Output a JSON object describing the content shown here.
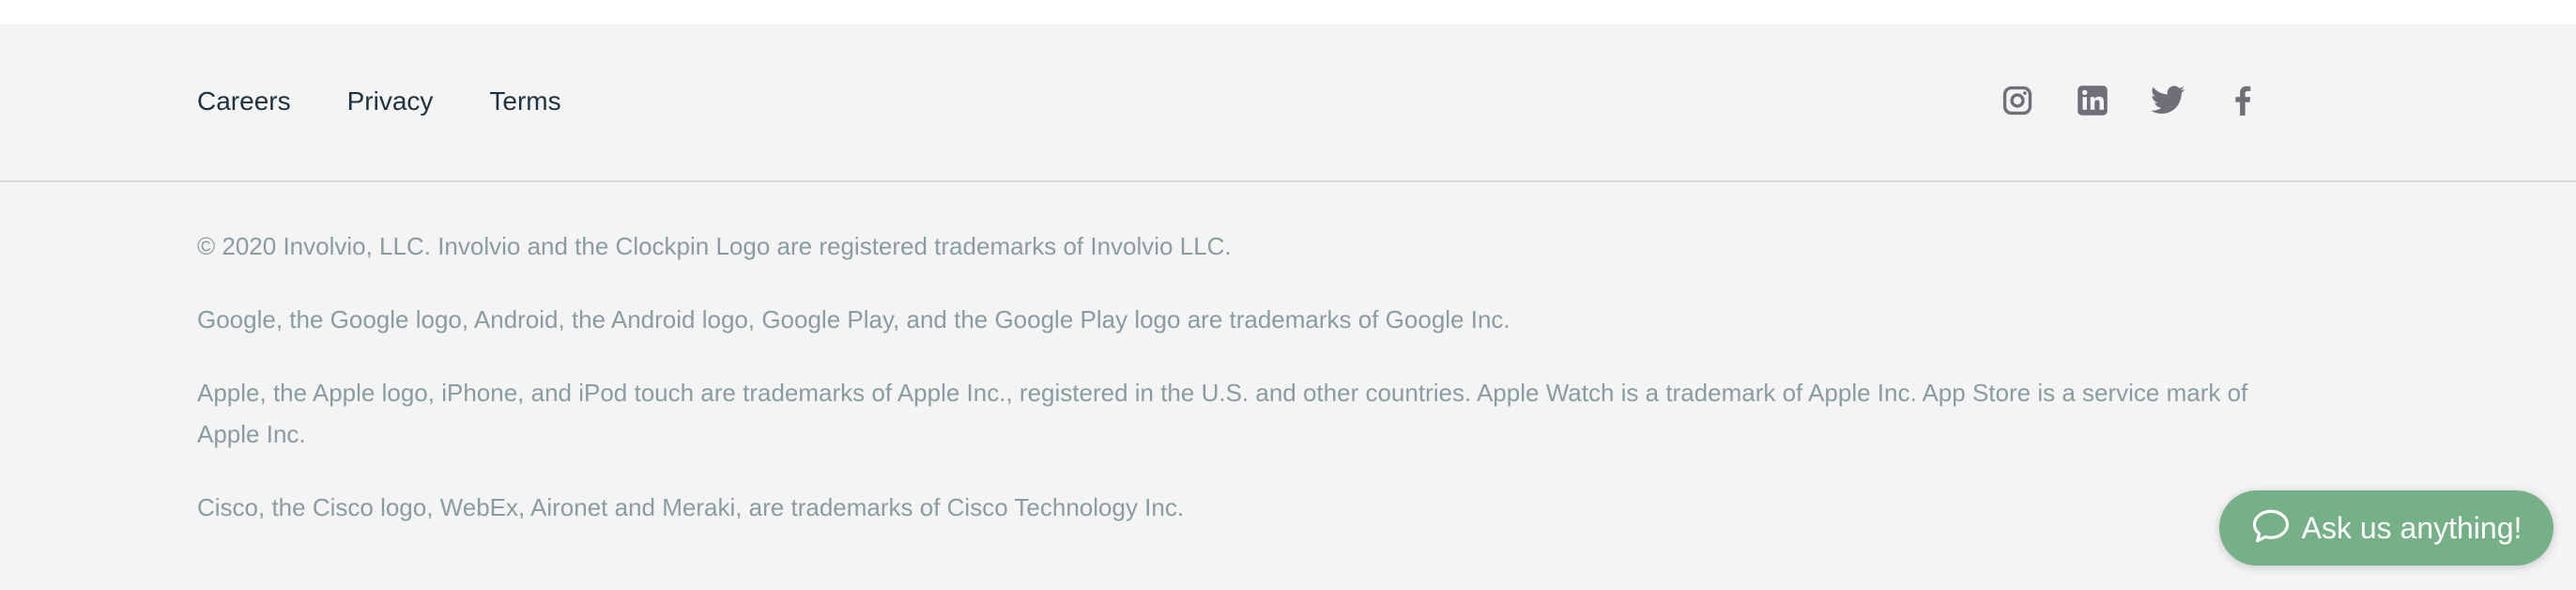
{
  "footer": {
    "links": [
      {
        "label": "Careers"
      },
      {
        "label": "Privacy"
      },
      {
        "label": "Terms"
      }
    ],
    "social": [
      {
        "icon": "instagram-icon"
      },
      {
        "icon": "linkedin-icon"
      },
      {
        "icon": "twitter-icon"
      },
      {
        "icon": "facebook-icon"
      }
    ]
  },
  "legal": {
    "copyright": "© 2020 Involvio, LLC. Involvio and the Clockpin Logo are registered trademarks of Involvio LLC.",
    "google": "Google, the Google logo, Android, the Android logo, Google Play, and the Google Play logo are trademarks of Google Inc.",
    "apple": "Apple, the Apple logo, iPhone, and iPod touch are trademarks of Apple Inc., registered in the U.S. and other countries. Apple Watch is a trademark of Apple Inc. App Store is a service mark of Apple Inc.",
    "cisco": "Cisco, the Cisco logo, WebEx, Aironet and Meraki, are trademarks of Cisco Technology Inc."
  },
  "chat": {
    "label": "Ask us anything!",
    "icon": "chat-bubble-icon"
  },
  "colors": {
    "background": "#f4f4f4",
    "link": "#1f3240",
    "legal_text": "#8a9ca0",
    "icon": "#6f6f78",
    "chat_button": "#76b087"
  }
}
